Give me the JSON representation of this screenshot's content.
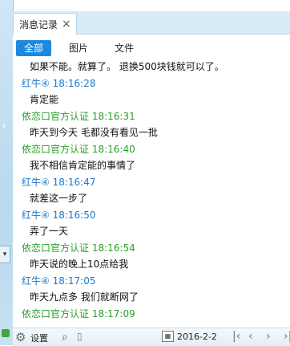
{
  "tab": {
    "label": "消息记录",
    "close": "×"
  },
  "filters": [
    "全部",
    "图片",
    "文件"
  ],
  "messages": [
    {
      "kind": "content",
      "text": "如果不能。就算了。 退换500块钱就可以了。"
    },
    {
      "kind": "sender",
      "color": "blue",
      "text": "红牛④ 18:16:28"
    },
    {
      "kind": "content",
      "text": "肯定能"
    },
    {
      "kind": "sender",
      "color": "green",
      "text": "依恋口官方认证 18:16:31"
    },
    {
      "kind": "content",
      "text": "昨天到今天 毛都没有看见一批"
    },
    {
      "kind": "sender",
      "color": "green",
      "text": "依恋口官方认证 18:16:40"
    },
    {
      "kind": "content",
      "text": "我不相信肯定能的事情了"
    },
    {
      "kind": "sender",
      "color": "blue",
      "text": "红牛④ 18:16:47"
    },
    {
      "kind": "content",
      "text": "就差这一步了"
    },
    {
      "kind": "sender",
      "color": "blue",
      "text": "红牛④ 18:16:50"
    },
    {
      "kind": "content",
      "text": "弄了一天"
    },
    {
      "kind": "sender",
      "color": "green",
      "text": "依恋口官方认证 18:16:54"
    },
    {
      "kind": "content",
      "text": "昨天说的晚上10点给我"
    },
    {
      "kind": "sender",
      "color": "blue",
      "text": "红牛④ 18:17:05"
    },
    {
      "kind": "content",
      "text": "昨天九点多 我们就断网了"
    },
    {
      "kind": "sender",
      "color": "green",
      "text": "依恋口官方认证 18:17:09"
    }
  ],
  "bottom": {
    "settings": "设置",
    "date": "2016-2-2",
    "icons": [
      "gear-icon",
      "search-icon",
      "calendar-icon",
      "first-page-icon",
      "prev-page-icon",
      "next-page-icon",
      "last-page-icon"
    ]
  },
  "colors": {
    "blue_sender": "#1a78d0",
    "green_sender": "#2aa02a",
    "active_filter": "#1b8ae0"
  }
}
